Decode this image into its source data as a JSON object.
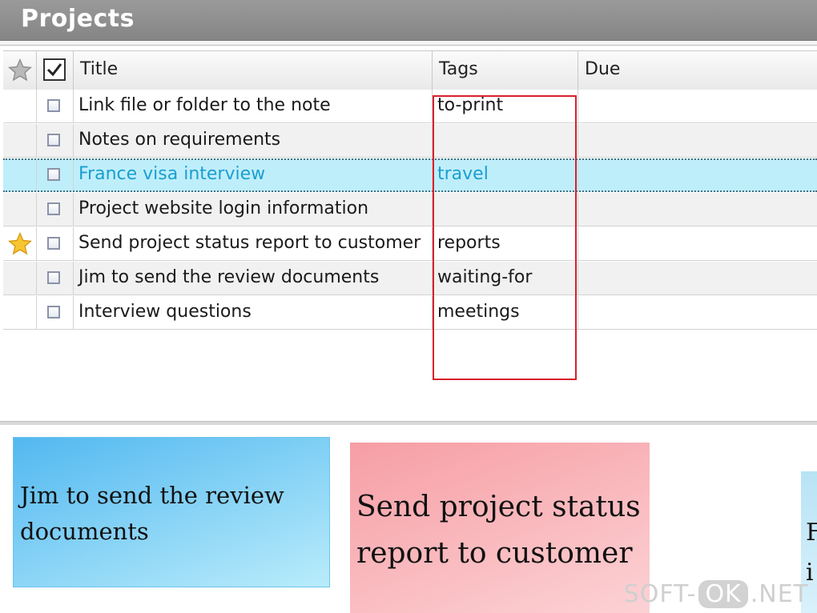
{
  "window": {
    "title": "Projects"
  },
  "grid": {
    "headers": {
      "title": "Title",
      "tags": "Tags",
      "due": "Due"
    },
    "rows": [
      {
        "title": "Link file or folder to the note",
        "tags": "to-print",
        "due": "",
        "starred": false,
        "selected": false
      },
      {
        "title": "Notes on requirements",
        "tags": "",
        "due": "",
        "starred": false,
        "selected": false
      },
      {
        "title": "France visa interview",
        "tags": "travel",
        "due": "",
        "starred": false,
        "selected": true
      },
      {
        "title": "Project website login information",
        "tags": "",
        "due": "",
        "starred": false,
        "selected": false
      },
      {
        "title": "Send project status report to customer",
        "tags": "reports",
        "due": "",
        "starred": true,
        "selected": false
      },
      {
        "title": "Jim to send the review documents",
        "tags": "waiting-for",
        "due": "",
        "starred": false,
        "selected": false
      },
      {
        "title": "Interview questions",
        "tags": "meetings",
        "due": "",
        "starred": false,
        "selected": false
      }
    ]
  },
  "cards": [
    {
      "text": "Jim to send the review documents",
      "color": "#52b8f0"
    },
    {
      "text": "Send project status report to customer",
      "color": "#f69ea4"
    },
    {
      "text": "F i",
      "color": "#b8e3f5"
    }
  ],
  "watermark": {
    "left": "SOFT-",
    "mid": "OK",
    "right": ".NET"
  },
  "colors": {
    "accent": "#1a9fd0",
    "selection": "#bfeefb",
    "highlight_frame": "#d8202c"
  },
  "icons": {
    "star_header": "star-outline-icon",
    "star_row": "star-filled-icon",
    "checkbox": "checkbox-icon"
  }
}
